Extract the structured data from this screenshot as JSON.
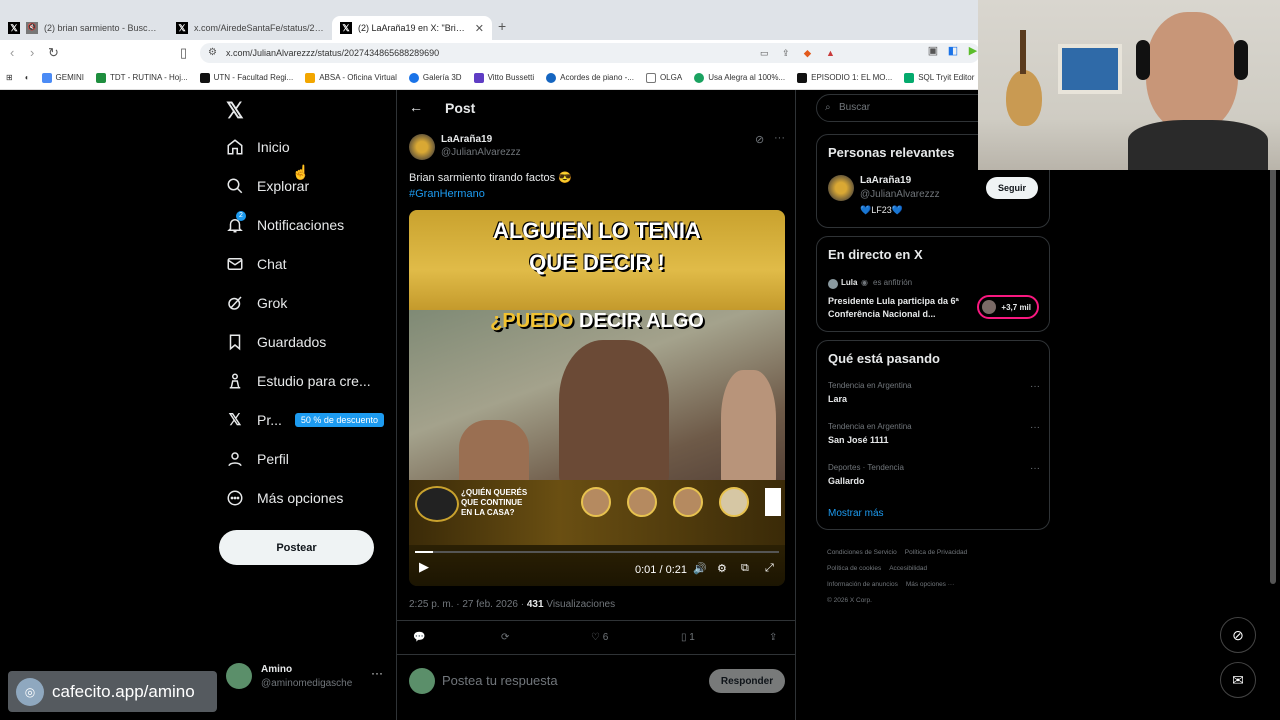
{
  "browser": {
    "tabs": [
      {
        "title": "(2) brian sarmiento - Buscar / X"
      },
      {
        "title": "x.com/AiredeSantaFe/status/2026678"
      },
      {
        "title": "(2) LaAraña19 en X: \"Brian sarmi"
      }
    ],
    "new_tab": "+",
    "close": "✕",
    "url": "x.com/JulianAlvarezzz/status/2027434865688289690",
    "bookmarks": [
      {
        "label": "GEMINI",
        "color": "#4b8bf5"
      },
      {
        "label": "TDT - RUTINA - Hoj...",
        "color": "#1e8e3e"
      },
      {
        "label": "UTN - Facultad Regi...",
        "color": "#111111"
      },
      {
        "label": "ABSA - Oficina Virtual",
        "color": "#f2a600"
      },
      {
        "label": "Galería 3D",
        "color": "#1a73e8"
      },
      {
        "label": "Vitto Bussetti",
        "color": "#5f3dc4"
      },
      {
        "label": "Acordes de piano -...",
        "color": "#1565c0"
      },
      {
        "label": "OLGA",
        "color": "#999999"
      },
      {
        "label": "Usa Alegra al 100%...",
        "color": "#1aa260"
      },
      {
        "label": "EPISODIO 1: EL MO...",
        "color": "#111111"
      },
      {
        "label": "SQL Tryit Editor",
        "color": "#04aa6d"
      }
    ]
  },
  "leftnav": {
    "items": [
      {
        "label": "Inicio",
        "icon": "home-icon"
      },
      {
        "label": "Explorar",
        "icon": "search-icon"
      },
      {
        "label": "Notificaciones",
        "icon": "bell-icon",
        "badge": "2"
      },
      {
        "label": "Chat",
        "icon": "mail-icon"
      },
      {
        "label": "Grok",
        "icon": "grok-icon"
      },
      {
        "label": "Guardados",
        "icon": "bookmark-icon"
      },
      {
        "label": "Estudio para cre...",
        "icon": "creator-icon"
      },
      {
        "label": "Pr...",
        "icon": "x-premium-icon",
        "promo": "50 % de descuento"
      },
      {
        "label": "Perfil",
        "icon": "user-icon"
      },
      {
        "label": "Más opciones",
        "icon": "more-circle-icon"
      }
    ],
    "post_button": "Postear",
    "account": {
      "name": "Amino",
      "handle": "@aminomedigasche",
      "more": "···"
    }
  },
  "post": {
    "header": "Post",
    "author": "LaAraña19",
    "handle": "@JulianAlvarezzz",
    "text": "Brian sarmiento tirando factos 😎",
    "hashtag": "#GranHermano",
    "video": {
      "line1": "ALGUIEN LO TENIA",
      "line2": "QUE DECIR !",
      "caption_highlight": "¿PUEDO",
      "caption_rest": " DECIR ALGO",
      "banner_line1": "¿QUIÉN QUERÉS",
      "banner_line2": "QUE CONTINUE",
      "banner_line3": "EN LA CASA?",
      "time": "0:01 / 0:21",
      "progress": 0.05
    },
    "timestamp": "2:25 p. m. · 27 feb. 2026 · ",
    "views_count": "431",
    "views_label": " Visualizaciones",
    "likes": "6",
    "bookmarks": "1",
    "reply_placeholder": "Postea tu respuesta",
    "reply_button": "Responder"
  },
  "right": {
    "search_placeholder": "Buscar",
    "relevant": {
      "title": "Personas relevantes",
      "name": "LaAraña19",
      "handle": "@JulianAlvarezzz",
      "bio": "💙LF23💙",
      "follow": "Seguir"
    },
    "live": {
      "title": "En directo en X",
      "host": "Lula",
      "host_role": "es anfitrión",
      "headline": "Presidente Lula participa da 6ª Conferência Nacional d...",
      "listeners": "+3,7 mil"
    },
    "trends": {
      "title": "Qué está pasando",
      "items": [
        {
          "category": "Tendencia en Argentina",
          "name": "Lara"
        },
        {
          "category": "Tendencia en Argentina",
          "name": "San José 1111"
        },
        {
          "category": "Deportes · Tendencia",
          "name": "Gallardo"
        }
      ],
      "more": "Mostrar más"
    },
    "footer": {
      "links": [
        "Condiciones de Servicio",
        "Política de Privacidad",
        "Política de cookies",
        "Accesibilidad",
        "Información de anuncios",
        "Más opciones ···"
      ],
      "copyright": "© 2026 X Corp."
    }
  },
  "watermark": "cafecito.app/amino"
}
